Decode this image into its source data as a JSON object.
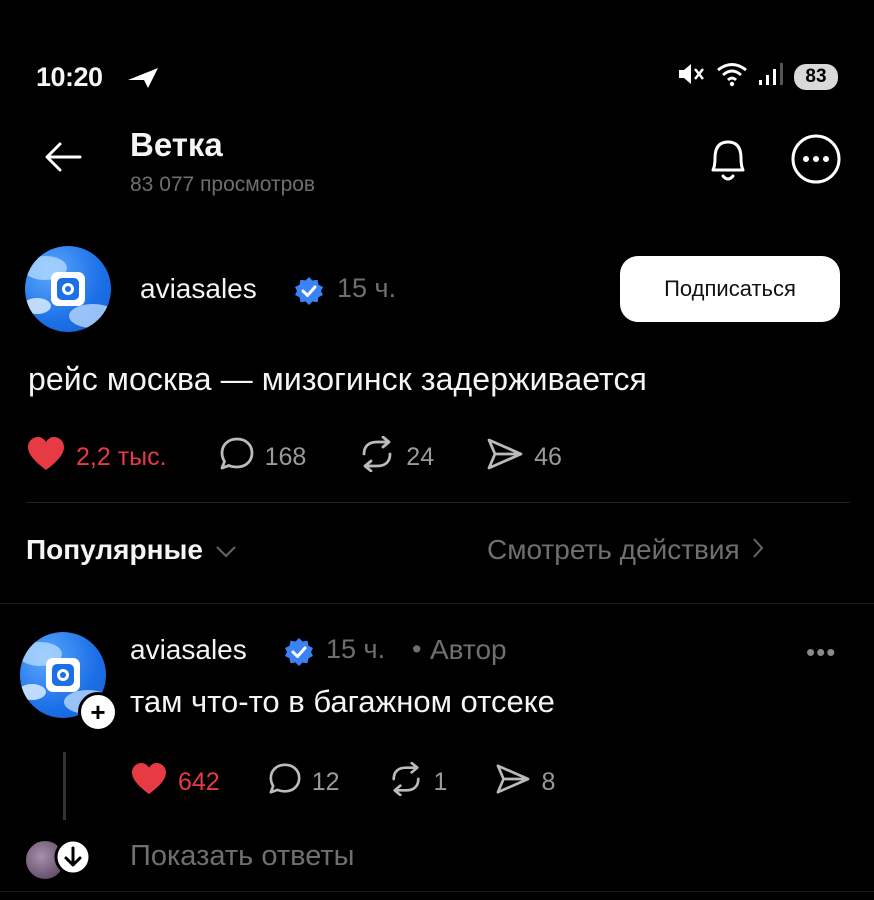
{
  "status_bar": {
    "time": "10:20",
    "battery": "83",
    "icons": [
      "location-arrow-icon",
      "mute-icon",
      "wifi-icon",
      "signal-icon",
      "battery-icon"
    ]
  },
  "header": {
    "title": "Ветка",
    "views": "83 077 просмотров",
    "icons": [
      "back-arrow-icon",
      "bell-icon",
      "more-circle-icon"
    ]
  },
  "post": {
    "author": "aviasales",
    "time": "15 ч.",
    "subscribe_label": "Подписаться",
    "text": "рейс москва — мизогинск задерживается",
    "likes": "2,2 тыс.",
    "comments": "168",
    "reposts": "24",
    "shares": "46"
  },
  "feed_controls": {
    "sort_label": "Популярные",
    "view_actions_label": "Смотреть действия"
  },
  "reply": {
    "author": "aviasales",
    "time": "15 ч.",
    "separator": "•",
    "author_tag": "Автор",
    "more": "•••",
    "text": "там что-то в багажном отсеке",
    "likes": "642",
    "comments": "12",
    "reposts": "1",
    "shares": "8"
  },
  "show_replies_label": "Показать ответы",
  "colors": {
    "background": "#000000",
    "like": "#e63a45",
    "verified": "#3b82f6",
    "avatar": "#1c6fe6",
    "muted_text": "#6f6f6f"
  }
}
